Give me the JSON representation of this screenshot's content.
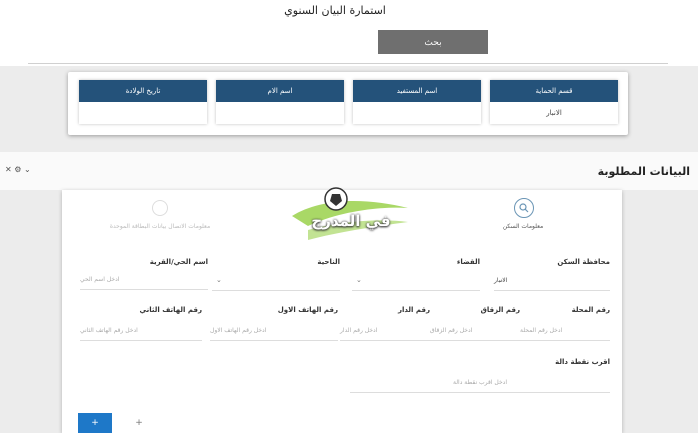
{
  "form": {
    "title": "استمارة البيان السنوي",
    "search_label": "بحث"
  },
  "cards": [
    {
      "header": "قسم الحماية",
      "value": "الانبار"
    },
    {
      "header": "اسم المستفيد",
      "value": ""
    },
    {
      "header": "اسم الام",
      "value": ""
    },
    {
      "header": "تاريخ الولادة",
      "value": ""
    }
  ],
  "section": {
    "title": "البيانات المطلوبة",
    "controls": "✕ ⚙ ⌄"
  },
  "steps": {
    "step1": "معلومات السكن",
    "step2": "معلومات الاتصال بيانات البطاقة الموحدة"
  },
  "logo": {
    "text": "في المدرج"
  },
  "fields": {
    "governorate": {
      "label": "محافظة السكن",
      "value": "الانبار"
    },
    "district": {
      "label": "القضاء",
      "value": ""
    },
    "subdistrict": {
      "label": "الناحية",
      "value": ""
    },
    "neighborhood": {
      "label": "اسم الحي/القرية",
      "placeholder": "ادخل اسم الحي"
    },
    "mahalla": {
      "label": "رقم المحلة",
      "placeholder": "ادخل رقم المحلة"
    },
    "alley": {
      "label": "رقم الزقاق",
      "placeholder": "ادخل رقم الزقاق"
    },
    "house": {
      "label": "رقم الدار",
      "placeholder": "ادخل رقم الدار"
    },
    "phone1": {
      "label": "رقم الهاتف الاول",
      "placeholder": "ادخل رقم الهاتف الاول"
    },
    "phone2": {
      "label": "رقم الهاتف الثاني",
      "placeholder": "ادخل رقم الهاتف الثاني"
    },
    "landmark": {
      "label": "اقرب نقطة دالة",
      "placeholder": "ادخل اقرب نقطة دالة"
    }
  },
  "actions": {
    "add": "+",
    "remove": "+"
  }
}
